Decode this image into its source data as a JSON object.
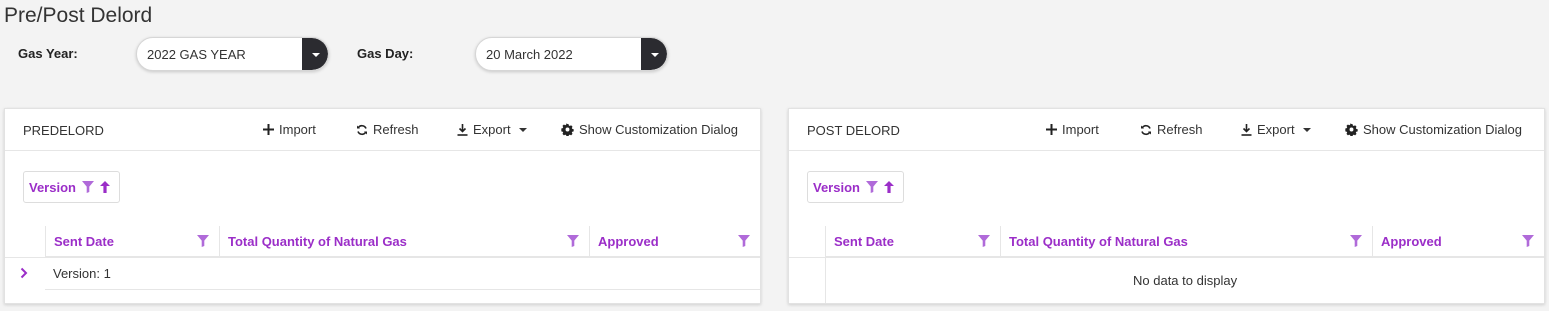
{
  "page": {
    "title": "Pre/Post Delord"
  },
  "filters": {
    "gas_year": {
      "label": "Gas Year:",
      "value": "2022 GAS YEAR"
    },
    "gas_day": {
      "label": "Gas Day:",
      "value": "20 March 2022"
    }
  },
  "toolbar": {
    "import_label": "Import",
    "refresh_label": "Refresh",
    "export_label": "Export",
    "customize_label": "Show Customization Dialog"
  },
  "columns": {
    "sent_date": "Sent Date",
    "total_quantity": "Total Quantity of Natural Gas",
    "approved": "Approved"
  },
  "predelord": {
    "title": "PREDELORD",
    "group_by": "Version",
    "group_row": "Version: 1"
  },
  "postdelord": {
    "title": "POST DELORD",
    "group_by": "Version",
    "empty_text": "No data to display"
  },
  "colors": {
    "accent": "#9b2ec8",
    "dropdown_button": "#2b2b30"
  }
}
